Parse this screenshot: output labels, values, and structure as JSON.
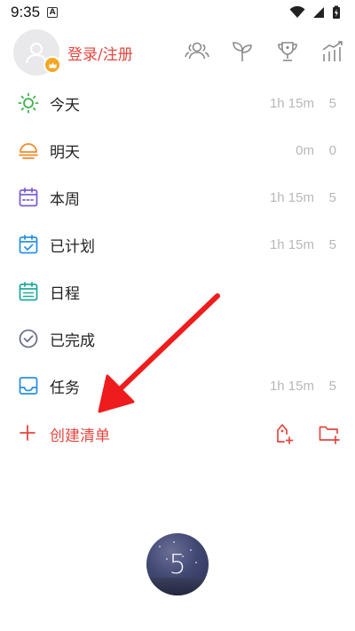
{
  "status_bar": {
    "time": "9:35",
    "notification_icon": "a-box-icon",
    "right_icons": [
      "wifi-icon",
      "signal-icon",
      "battery-charging-icon"
    ]
  },
  "header": {
    "login_label": "登录/注册",
    "icons": [
      "friends-icon",
      "sprout-icon",
      "trophy-icon",
      "stats-chart-icon"
    ]
  },
  "list": {
    "items": [
      {
        "label": "今天",
        "time": "1h 15m",
        "count": "5",
        "icon": "sun-icon",
        "color": "#3bb34a"
      },
      {
        "label": "明天",
        "time": "0m",
        "count": "0",
        "icon": "sunset-icon",
        "color": "#f28a2b"
      },
      {
        "label": "本周",
        "time": "1h 15m",
        "count": "5",
        "icon": "calendar-week-icon",
        "color": "#7b5fd6"
      },
      {
        "label": "已计划",
        "time": "1h 15m",
        "count": "5",
        "icon": "calendar-check-icon",
        "color": "#2b90e6"
      },
      {
        "label": "日程",
        "time": "",
        "count": "",
        "icon": "schedule-icon",
        "color": "#23a89b"
      },
      {
        "label": "已完成",
        "time": "",
        "count": "",
        "icon": "check-circle-icon",
        "color": "#6d7089"
      },
      {
        "label": "任务",
        "time": "1h 15m",
        "count": "5",
        "icon": "inbox-icon",
        "color": "#2b90e6"
      }
    ],
    "create_label": "创建清单"
  },
  "pomodoro": {
    "number": "5"
  },
  "colors": {
    "accent": "#e5463f",
    "muted": "#b8b8b8",
    "arrow": "#ee1c1c"
  }
}
